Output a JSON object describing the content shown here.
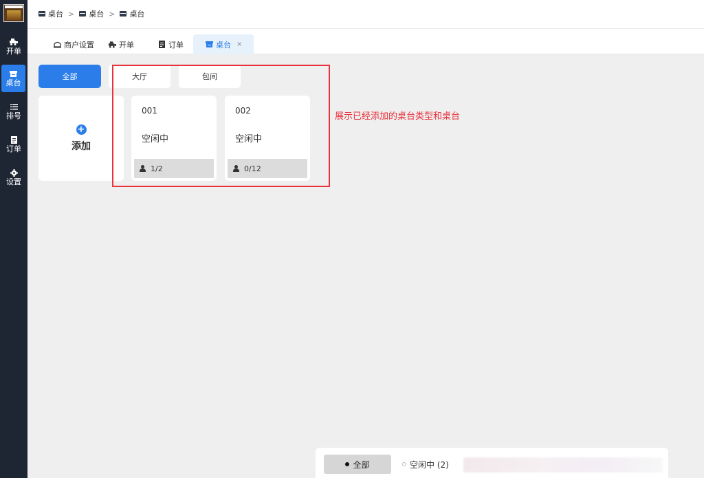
{
  "sidebar": {
    "items": [
      {
        "label": "开单",
        "icon": "car-icon"
      },
      {
        "label": "桌台",
        "icon": "table-icon"
      },
      {
        "label": "排号",
        "icon": "list-icon"
      },
      {
        "label": "订单",
        "icon": "order-icon"
      },
      {
        "label": "设置",
        "icon": "gear-icon"
      }
    ]
  },
  "breadcrumb": [
    "桌台",
    "桌台",
    "桌台"
  ],
  "breadcrumb_sep": ">",
  "tabs": [
    {
      "label": "商户设置",
      "icon": "shop-icon"
    },
    {
      "label": "开单",
      "icon": "car-icon"
    },
    {
      "label": "订单",
      "icon": "order-icon"
    },
    {
      "label": "桌台",
      "icon": "table-icon",
      "active": true,
      "close": "×"
    }
  ],
  "categories": [
    "全部",
    "大厅",
    "包间"
  ],
  "add_card": {
    "label": "添加",
    "icon": "plus-icon"
  },
  "tables": [
    {
      "number": "001",
      "status": "空闲中",
      "seats": "1/2"
    },
    {
      "number": "002",
      "status": "空闲中",
      "seats": "0/12"
    }
  ],
  "annotation": "展示已经添加的桌台类型和桌台",
  "bottom_filter": {
    "all": "全部",
    "idle": "空闲中 (2)"
  },
  "colors": {
    "accent": "#2b7de9",
    "sidebar": "#1f2633",
    "annotation": "#e8323c"
  }
}
